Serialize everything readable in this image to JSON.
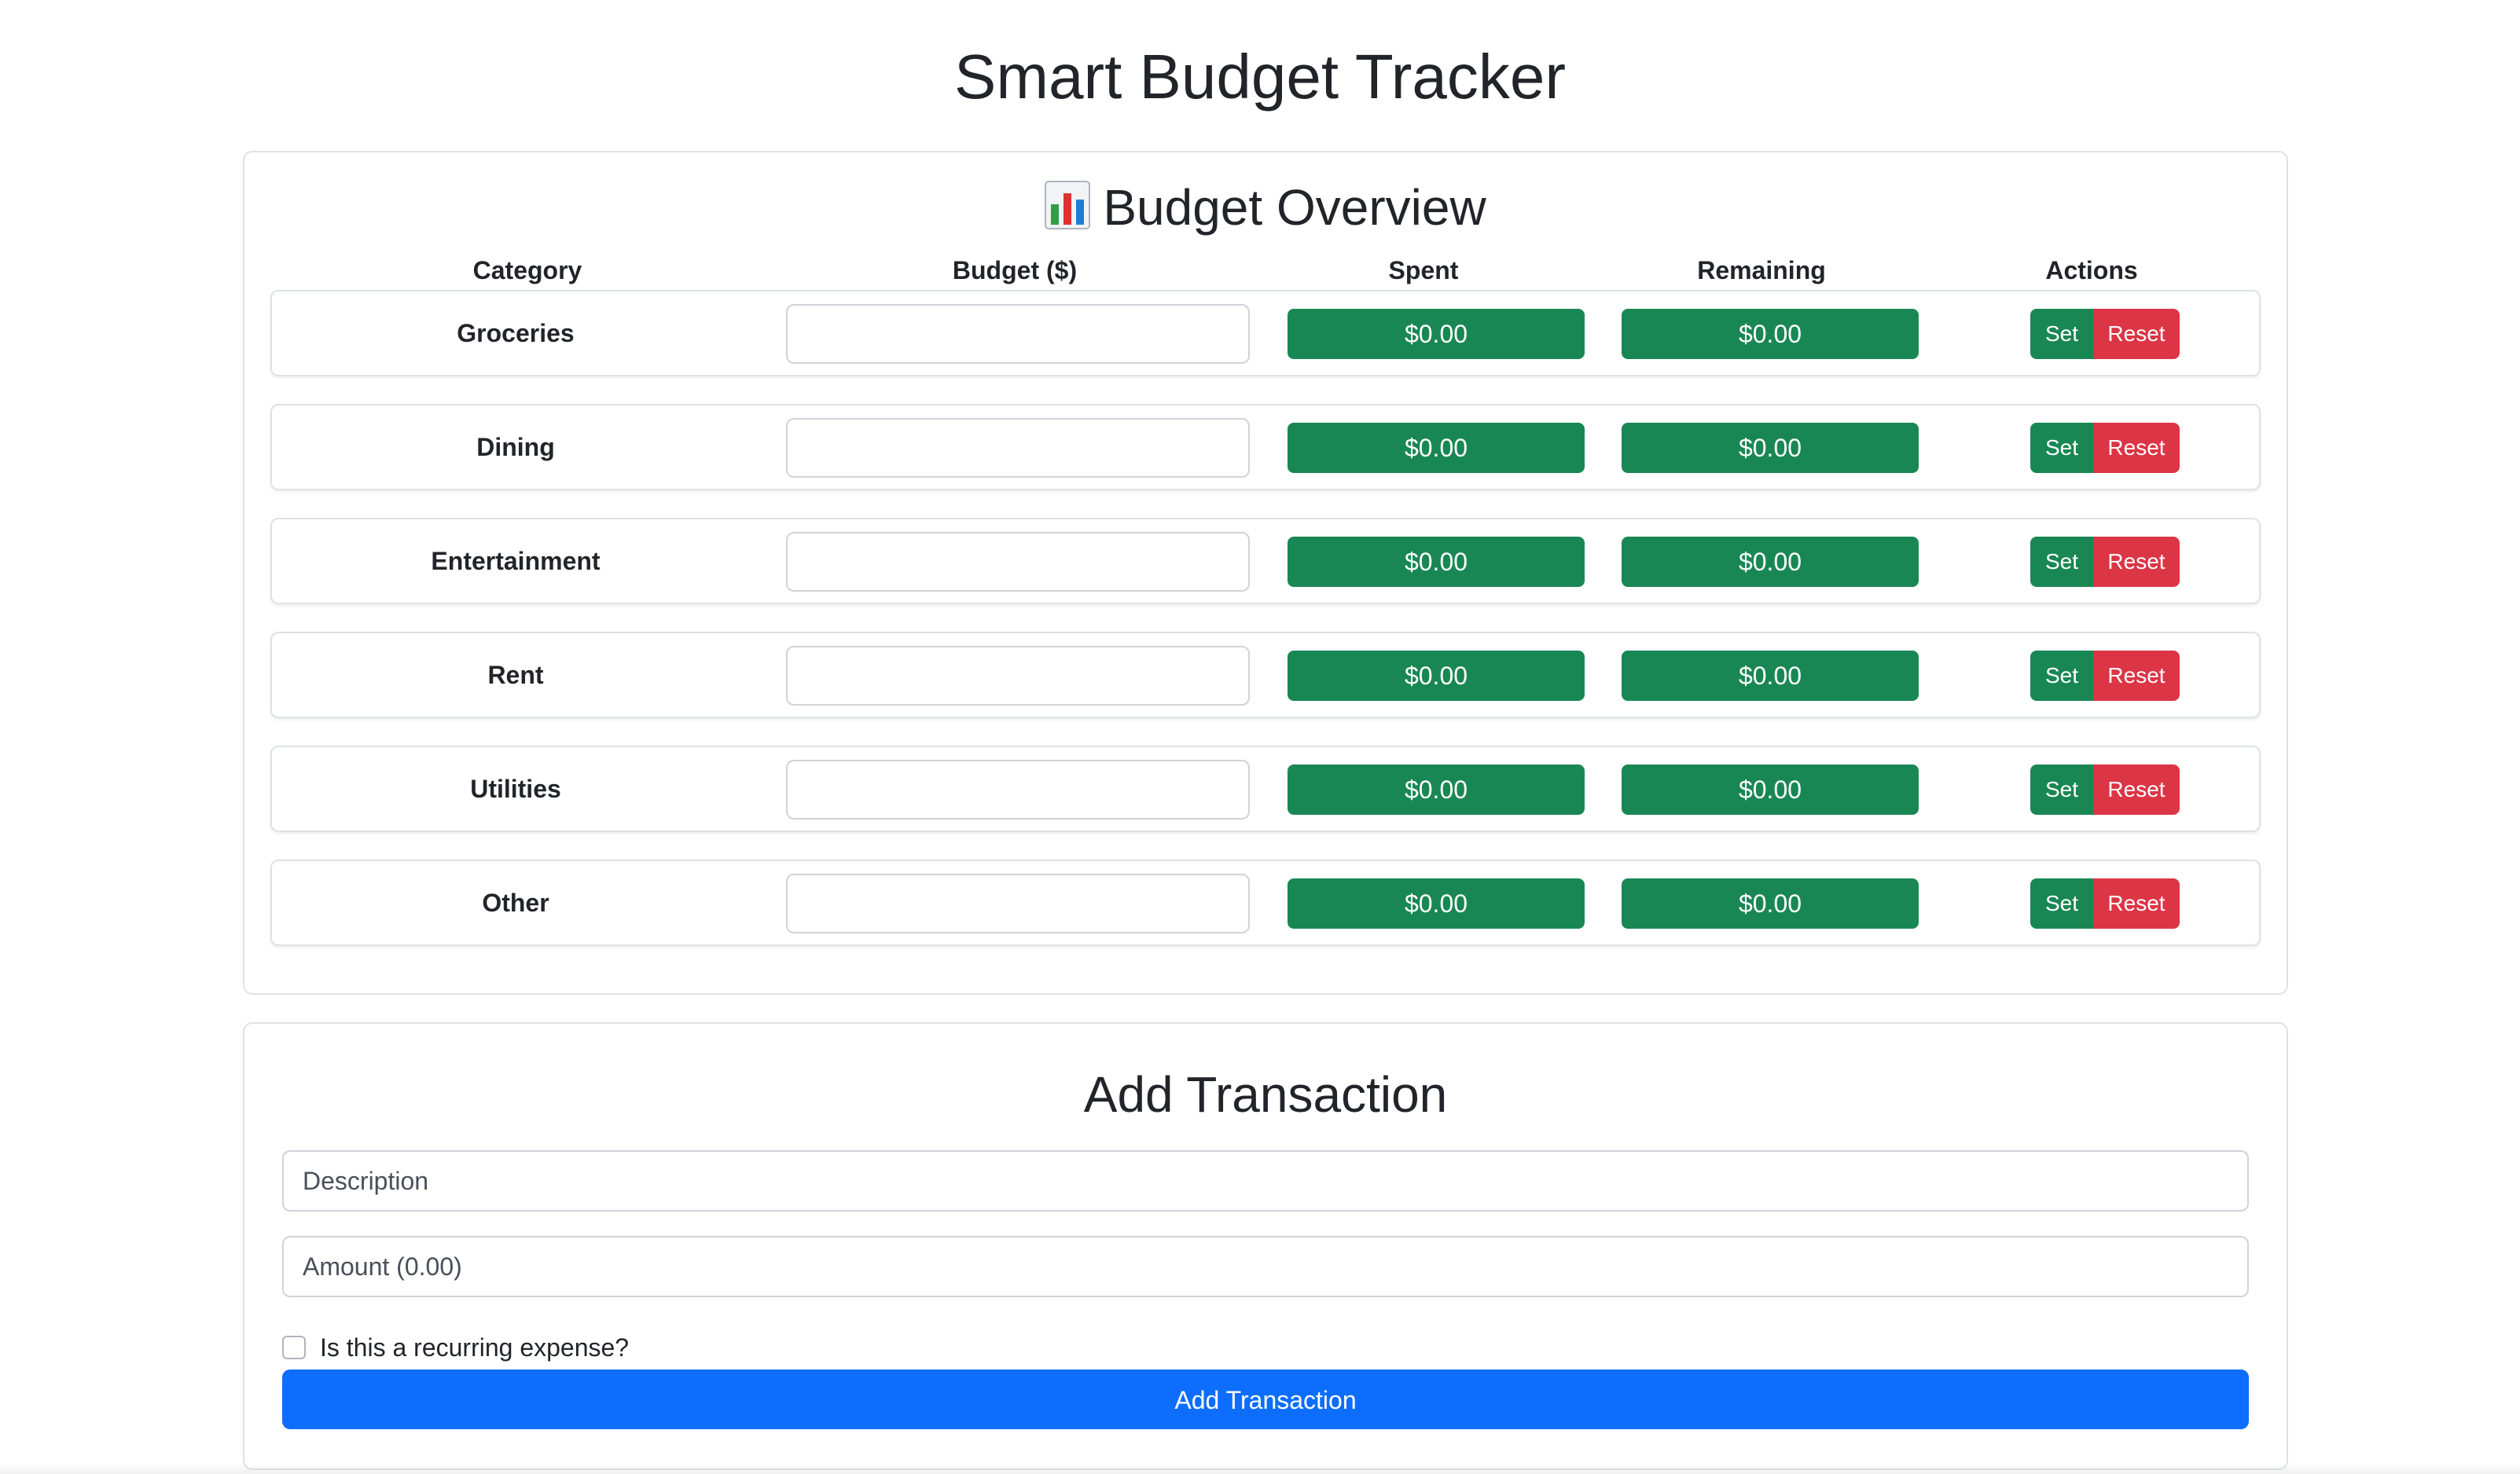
{
  "page": {
    "title": "Smart Budget Tracker"
  },
  "overview": {
    "title": "Budget Overview",
    "icon": "bar-chart-icon",
    "headers": {
      "category": "Category",
      "budget": "Budget ($)",
      "spent": "Spent",
      "remaining": "Remaining",
      "actions": "Actions"
    },
    "set_label": "Set",
    "reset_label": "Reset",
    "rows": [
      {
        "category": "Groceries",
        "budget_value": "",
        "spent": "$0.00",
        "remaining": "$0.00"
      },
      {
        "category": "Dining",
        "budget_value": "",
        "spent": "$0.00",
        "remaining": "$0.00"
      },
      {
        "category": "Entertainment",
        "budget_value": "",
        "spent": "$0.00",
        "remaining": "$0.00"
      },
      {
        "category": "Rent",
        "budget_value": "",
        "spent": "$0.00",
        "remaining": "$0.00"
      },
      {
        "category": "Utilities",
        "budget_value": "",
        "spent": "$0.00",
        "remaining": "$0.00"
      },
      {
        "category": "Other",
        "budget_value": "",
        "spent": "$0.00",
        "remaining": "$0.00"
      }
    ]
  },
  "transaction": {
    "title": "Add Transaction",
    "description_placeholder": "Description",
    "amount_placeholder": "Amount (0.00)",
    "recurring_label": "Is this a recurring expense?",
    "recurring_checked": false,
    "submit_label": "Add Transaction"
  },
  "colors": {
    "success": "#198754",
    "danger": "#dc3545",
    "primary": "#0d6efd",
    "border": "#dee2e6"
  }
}
